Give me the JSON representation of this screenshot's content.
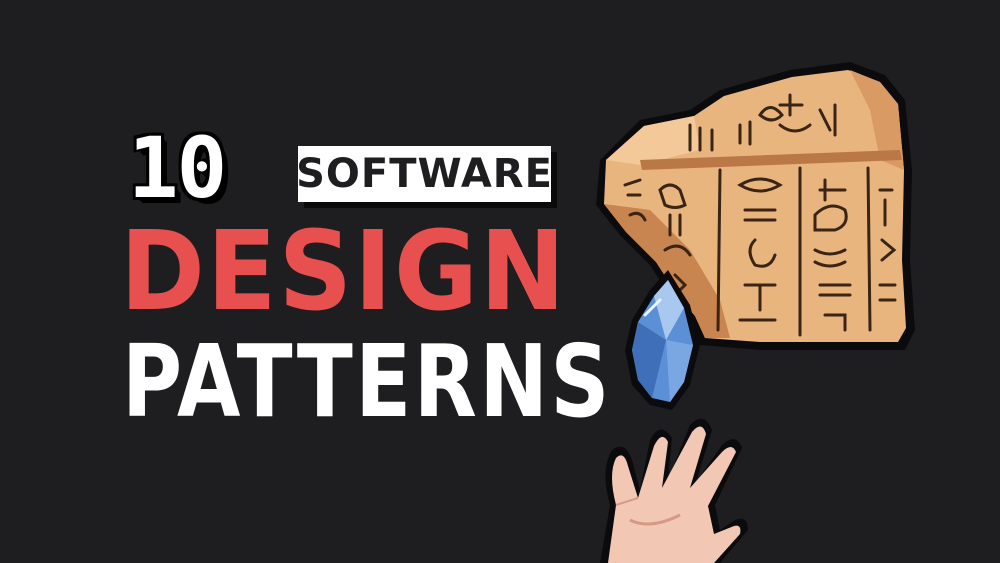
{
  "title": {
    "number": "10",
    "word1": "SOFTWARE",
    "word2": "DESIGN",
    "word3": "PATTERNS"
  },
  "colors": {
    "background": "#1e1e20",
    "accent_red": "#e8504f",
    "white": "#ffffff",
    "stone": "#e9b57f",
    "gem_blue": "#5b8fd6"
  },
  "illustration": {
    "tablet": "stone-tablet-hieroglyphs",
    "gem": "blue-crystal",
    "hand": "open-hand"
  }
}
